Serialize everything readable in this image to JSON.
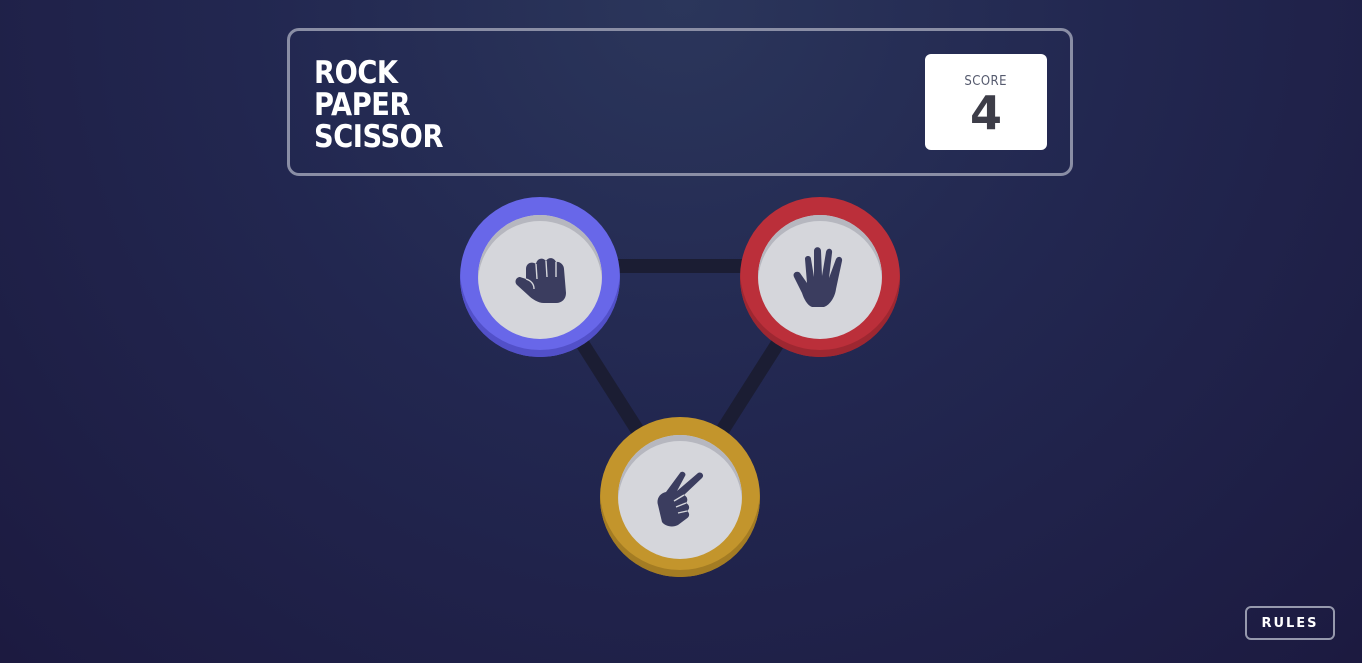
{
  "header": {
    "title_lines": [
      "ROCK",
      "PAPER",
      "SCISSOR"
    ],
    "score_label": "SCORE",
    "score_value": "4"
  },
  "choices": [
    {
      "id": "rock",
      "icon": "fist-icon",
      "color": "#6867e9"
    },
    {
      "id": "paper",
      "icon": "open-hand-icon",
      "color": "#bb2f3a"
    },
    {
      "id": "scissors",
      "icon": "peace-hand-icon",
      "color": "#c3952c"
    }
  ],
  "colors": {
    "background_top": "#2b365b",
    "background_bottom": "#1c1a40",
    "icon_fill": "#3b3d5f",
    "connector": "#1b1d33"
  },
  "rules_button": {
    "label": "RULES"
  }
}
